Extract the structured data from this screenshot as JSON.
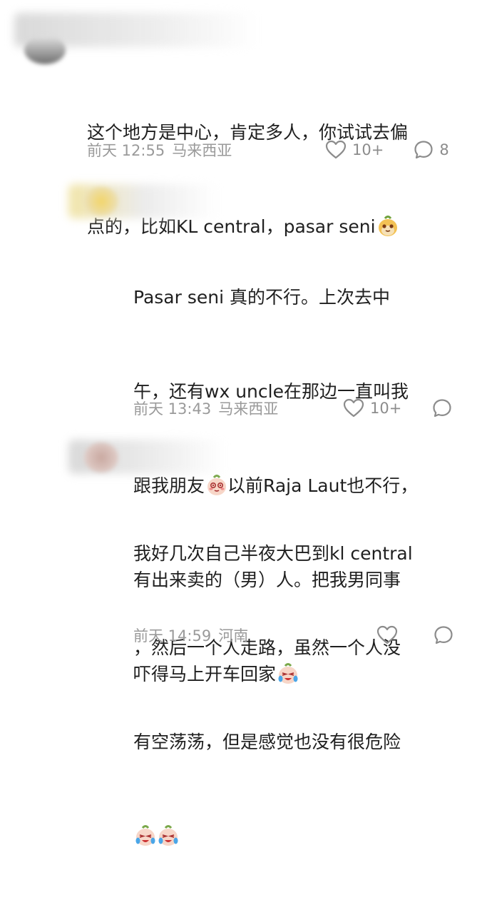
{
  "comments": [
    {
      "lines": [
        "这个地方是中心，肯定多人，你试试去偏",
        "点的，比如KL central，pasar seni"
      ],
      "date": "前天 12:55",
      "location": "马来西亚",
      "likes": "10+",
      "replies": "8"
    },
    {
      "lines": [
        "Pasar seni 真的不行。上次去中",
        "午，还有wx uncle在那边一直叫我",
        "跟我朋友",
        "以前Raja Laut也不行，",
        "有出来卖的（男）人。把我男同事",
        "吓得马上开车回家"
      ],
      "date": "前天 13:43",
      "location": "马来西亚",
      "likes": "10+",
      "replies": ""
    },
    {
      "lines": [
        "我好几次自己半夜大巴到kl central",
        "，然后一个人走路，虽然一个人没",
        "有空荡荡，但是感觉也没有很危险"
      ],
      "date": "前天 14:59",
      "location": "河南",
      "likes": "",
      "replies": ""
    }
  ],
  "icons": {
    "like": "heart-outline-icon",
    "reply": "speech-bubble-icon",
    "emoji_smug": "smug-face-emoji",
    "emoji_shy": "shy-face-emoji",
    "emoji_cry": "crying-face-emoji"
  },
  "colors": {
    "meta": "#9a9a9a",
    "icon": "#8c8c8c"
  }
}
